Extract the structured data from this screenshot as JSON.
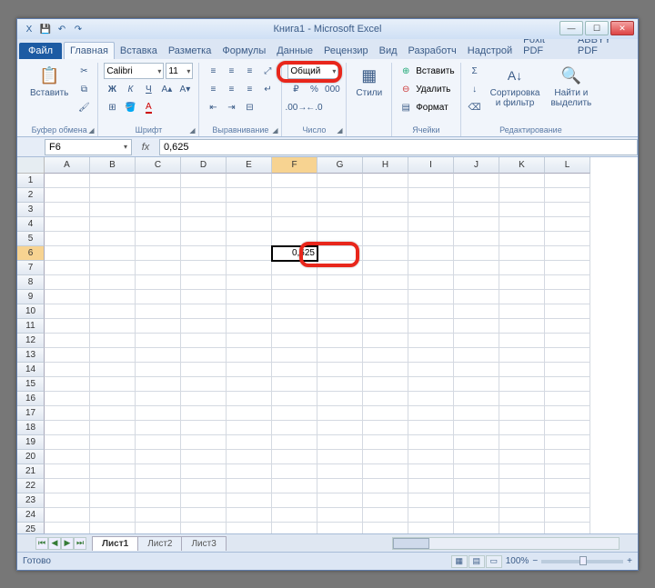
{
  "window": {
    "title": "Книга1 - Microsoft Excel",
    "controls": {
      "min": "—",
      "max": "☐",
      "close": "✕"
    }
  },
  "qat": [
    "X",
    "💾",
    "↶",
    "↷"
  ],
  "tabs": {
    "file": "Файл",
    "items": [
      "Главная",
      "Вставка",
      "Разметка",
      "Формулы",
      "Данные",
      "Рецензир",
      "Вид",
      "Разработч",
      "Надстрой",
      "Foxit PDF",
      "ABBYY PDF"
    ],
    "active": 0
  },
  "ribbon": {
    "clipboard": {
      "label": "Буфер обмена",
      "paste": "Вставить"
    },
    "font": {
      "label": "Шрифт",
      "name": "Calibri",
      "size": "11"
    },
    "align": {
      "label": "Выравнивание"
    },
    "number": {
      "label": "Число",
      "format": "Общий"
    },
    "styles": {
      "label": "Стили"
    },
    "cells": {
      "label": "Ячейки",
      "insert": "Вставить",
      "delete": "Удалить",
      "format": "Формат"
    },
    "editing": {
      "label": "Редактирование",
      "sort": "Сортировка\nи фильтр",
      "find": "Найти и\nвыделить"
    }
  },
  "namebox": "F6",
  "formula": "0,625",
  "columns": [
    "A",
    "B",
    "C",
    "D",
    "E",
    "F",
    "G",
    "H",
    "I",
    "J",
    "K",
    "L"
  ],
  "rows": [
    "1",
    "2",
    "3",
    "4",
    "5",
    "6",
    "7",
    "8",
    "9",
    "10",
    "11",
    "12",
    "13",
    "14",
    "15",
    "16",
    "17",
    "18",
    "19",
    "20",
    "21",
    "22",
    "23",
    "24",
    "25"
  ],
  "active_cell": {
    "col": 5,
    "row": 5,
    "value": "0,625"
  },
  "sheets": {
    "items": [
      "Лист1",
      "Лист2",
      "Лист3"
    ],
    "active": 0
  },
  "status": {
    "ready": "Готово",
    "zoom": "100%"
  }
}
